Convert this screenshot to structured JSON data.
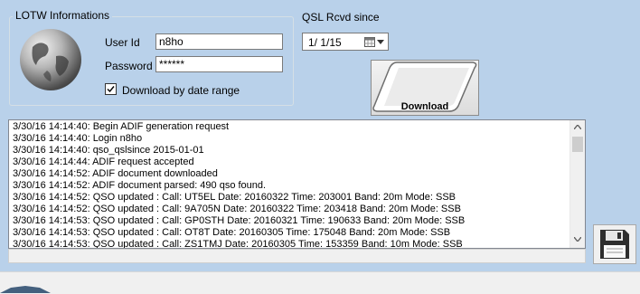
{
  "lotw": {
    "title": "LOTW Informations",
    "user_id_label": "User Id",
    "user_id_value": "n8ho",
    "password_label": "Password",
    "password_value": "******",
    "download_by_date_label": "Download by date range",
    "download_by_date_checked": true
  },
  "qsl": {
    "label": "QSL Rcvd since",
    "date_value": "1/  1/15"
  },
  "download_button": {
    "label": "Download"
  },
  "log": {
    "lines": [
      "3/30/16 14:14:40: Begin ADIF generation request",
      "3/30/16 14:14:40: Login n8ho",
      "3/30/16 14:14:40: qso_qslsince 2015-01-01",
      "3/30/16 14:14:44: ADIF request accepted",
      "3/30/16 14:14:52: ADIF document downloaded",
      "3/30/16 14:14:52: ADIF document parsed: 490 qso found.",
      "3/30/16 14:14:52: QSO updated :  Call: UT5EL Date: 20160322 Time: 203001 Band: 20m Mode: SSB",
      "3/30/16 14:14:52: QSO updated :  Call: 9A705N Date: 20160322 Time: 203418 Band: 20m Mode: SSB",
      "3/30/16 14:14:53: QSO updated :  Call: GP0STH Date: 20160321 Time: 190633 Band: 20m Mode: SSB",
      "3/30/16 14:14:53: QSO updated :  Call: OT8T Date: 20160305 Time: 175048 Band: 20m Mode: SSB",
      "3/30/16 14:14:53: QSO updated :  Call: ZS1TMJ Date: 20160305 Time: 153359 Band: 10m Mode: SSB"
    ]
  },
  "colors": {
    "background": "#b9d1ea",
    "window_control": "#f0f0f0"
  },
  "icons": {
    "globe": "globe-icon",
    "calendar": "calendar-icon",
    "dropdown": "chevron-down-icon",
    "save": "floppy-disk-icon"
  }
}
